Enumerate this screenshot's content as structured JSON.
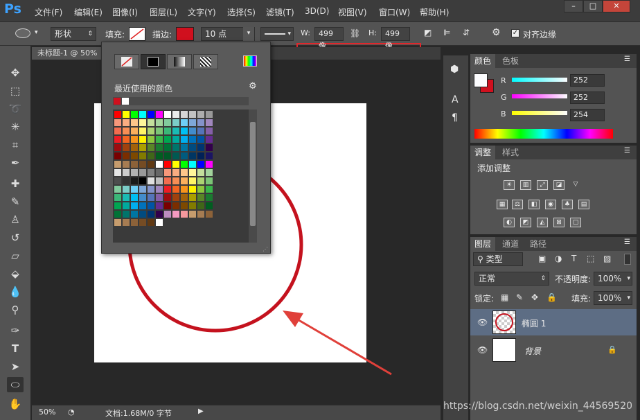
{
  "app": {
    "logo": "Ps"
  },
  "menu": [
    "文件(F)",
    "编辑(E)",
    "图像(I)",
    "图层(L)",
    "文字(Y)",
    "选择(S)",
    "滤镜(T)",
    "3D(D)",
    "视图(V)",
    "窗口(W)",
    "帮助(H)"
  ],
  "window_controls": [
    "–",
    "□",
    "✕"
  ],
  "options": {
    "mode_value": "形状",
    "fill_label": "填充:",
    "stroke_label": "描边:",
    "stroke_color": "#d0101e",
    "stroke_width": "10 点",
    "w_label": "W:",
    "w_value": "499 像",
    "h_label": "H:",
    "h_value": "499 像",
    "align_edges_label": "对齐边缘",
    "align_edges_checked": true
  },
  "document": {
    "tab_title": "未标题-1 @ 50%"
  },
  "status": {
    "zoom": "50%",
    "doc_info": "文档:1.68M/0 字节"
  },
  "picker": {
    "recent_label": "最近使用的颜色",
    "recent_colors": [
      "#d0101e",
      "#ffffff"
    ],
    "icons": [
      "no-color-icon",
      "solid-color-icon",
      "gradient-icon",
      "pattern-icon",
      "color-picker-icon"
    ],
    "palette": [
      "#ff0000",
      "#ffff00",
      "#00ff00",
      "#00ffff",
      "#0000ff",
      "#ff00ff",
      "#ffffff",
      "#ebebeb",
      "#d6d6d6",
      "#c2c2c2",
      "#adadad",
      "#999999",
      "#f7977a",
      "#f9ad81",
      "#fdc68a",
      "#fff79a",
      "#c4df9b",
      "#a3d39c",
      "#82ca9d",
      "#7bcdc8",
      "#6ecff6",
      "#7ea7d8",
      "#8493ca",
      "#a187be",
      "#f26c4f",
      "#f68e55",
      "#fbaf5c",
      "#fff467",
      "#acd372",
      "#7cc576",
      "#3bb878",
      "#1abbb4",
      "#00bff3",
      "#438ccb",
      "#5574b9",
      "#855fa8",
      "#ed1c24",
      "#f26522",
      "#f7941d",
      "#fff200",
      "#8dc63f",
      "#39b54a",
      "#00a651",
      "#00a99d",
      "#00aeef",
      "#0072bc",
      "#0054a6",
      "#662d91",
      "#9e0b0f",
      "#a0410d",
      "#a3620a",
      "#aba000",
      "#598527",
      "#1a7b30",
      "#007236",
      "#00746b",
      "#0076a3",
      "#004b80",
      "#003471",
      "#32004b",
      "#790000",
      "#7b2e00",
      "#7d4900",
      "#827b00",
      "#406618",
      "#005e20",
      "#005826",
      "#005952",
      "#005b7f",
      "#003663",
      "#002157",
      "#1b1464",
      "#c69c6d",
      "#a67c52",
      "#8c6239",
      "#754c24",
      "#603913",
      "#ffffff",
      "#ff0000",
      "#ffff00",
      "#00ff00",
      "#00ffff",
      "#0000ff",
      "#ff00ff",
      "#e6e6e6",
      "#cccccc",
      "#b3b3b3",
      "#999999",
      "#808080",
      "#666666",
      "#f7977a",
      "#f9ad81",
      "#fdc68a",
      "#fff79a",
      "#c4df9b",
      "#a3d39c",
      "#4d4d4d",
      "#333333",
      "#1a1a1a",
      "#000000",
      "#e0e0e0",
      "#bfbfbf",
      "#f26c4f",
      "#f68e55",
      "#fbaf5c",
      "#fff467",
      "#acd372",
      "#7cc576",
      "#82ca9d",
      "#7bcdc8",
      "#6ecff6",
      "#7ea7d8",
      "#8493ca",
      "#a187be",
      "#ed1c24",
      "#f26522",
      "#f7941d",
      "#fff200",
      "#8dc63f",
      "#39b54a",
      "#3bb878",
      "#1abbb4",
      "#00bff3",
      "#438ccb",
      "#5574b9",
      "#855fa8",
      "#9e0b0f",
      "#a0410d",
      "#a3620a",
      "#aba000",
      "#598527",
      "#1a7b30",
      "#00a651",
      "#00a99d",
      "#00aeef",
      "#0072bc",
      "#0054a6",
      "#662d91",
      "#790000",
      "#7b2e00",
      "#7d4900",
      "#827b00",
      "#406618",
      "#005e20",
      "#007236",
      "#00746b",
      "#0076a3",
      "#004b80",
      "#003471",
      "#32004b",
      "#bd8cbf",
      "#f49ac1",
      "#f5989d",
      "#c69c6d",
      "#a67c52",
      "#8c6239",
      "#c69c6d",
      "#a67c52",
      "#8c6239",
      "#754c24",
      "#603913",
      "#ffffff"
    ]
  },
  "color_panel": {
    "tabs": [
      "颜色",
      "色板"
    ],
    "r_label": "R",
    "g_label": "G",
    "b_label": "B",
    "r_value": "252",
    "g_value": "252",
    "b_value": "254",
    "foreground": "#fcfcfe",
    "background": "#d0101e"
  },
  "adjust_panel": {
    "tabs": [
      "调整",
      "样式"
    ],
    "title": "添加调整"
  },
  "layers_panel": {
    "tabs": [
      "图层",
      "通道",
      "路径"
    ],
    "filter_label": "类型",
    "blend_mode": "正常",
    "opacity_label": "不透明度:",
    "opacity_value": "100%",
    "lock_label": "锁定:",
    "fill_label": "填充:",
    "fill_value": "100%",
    "layers": [
      {
        "name": "椭圆 1"
      },
      {
        "name": "背景"
      }
    ]
  },
  "watermark": "https://blog.csdn.net/weixin_44569520"
}
